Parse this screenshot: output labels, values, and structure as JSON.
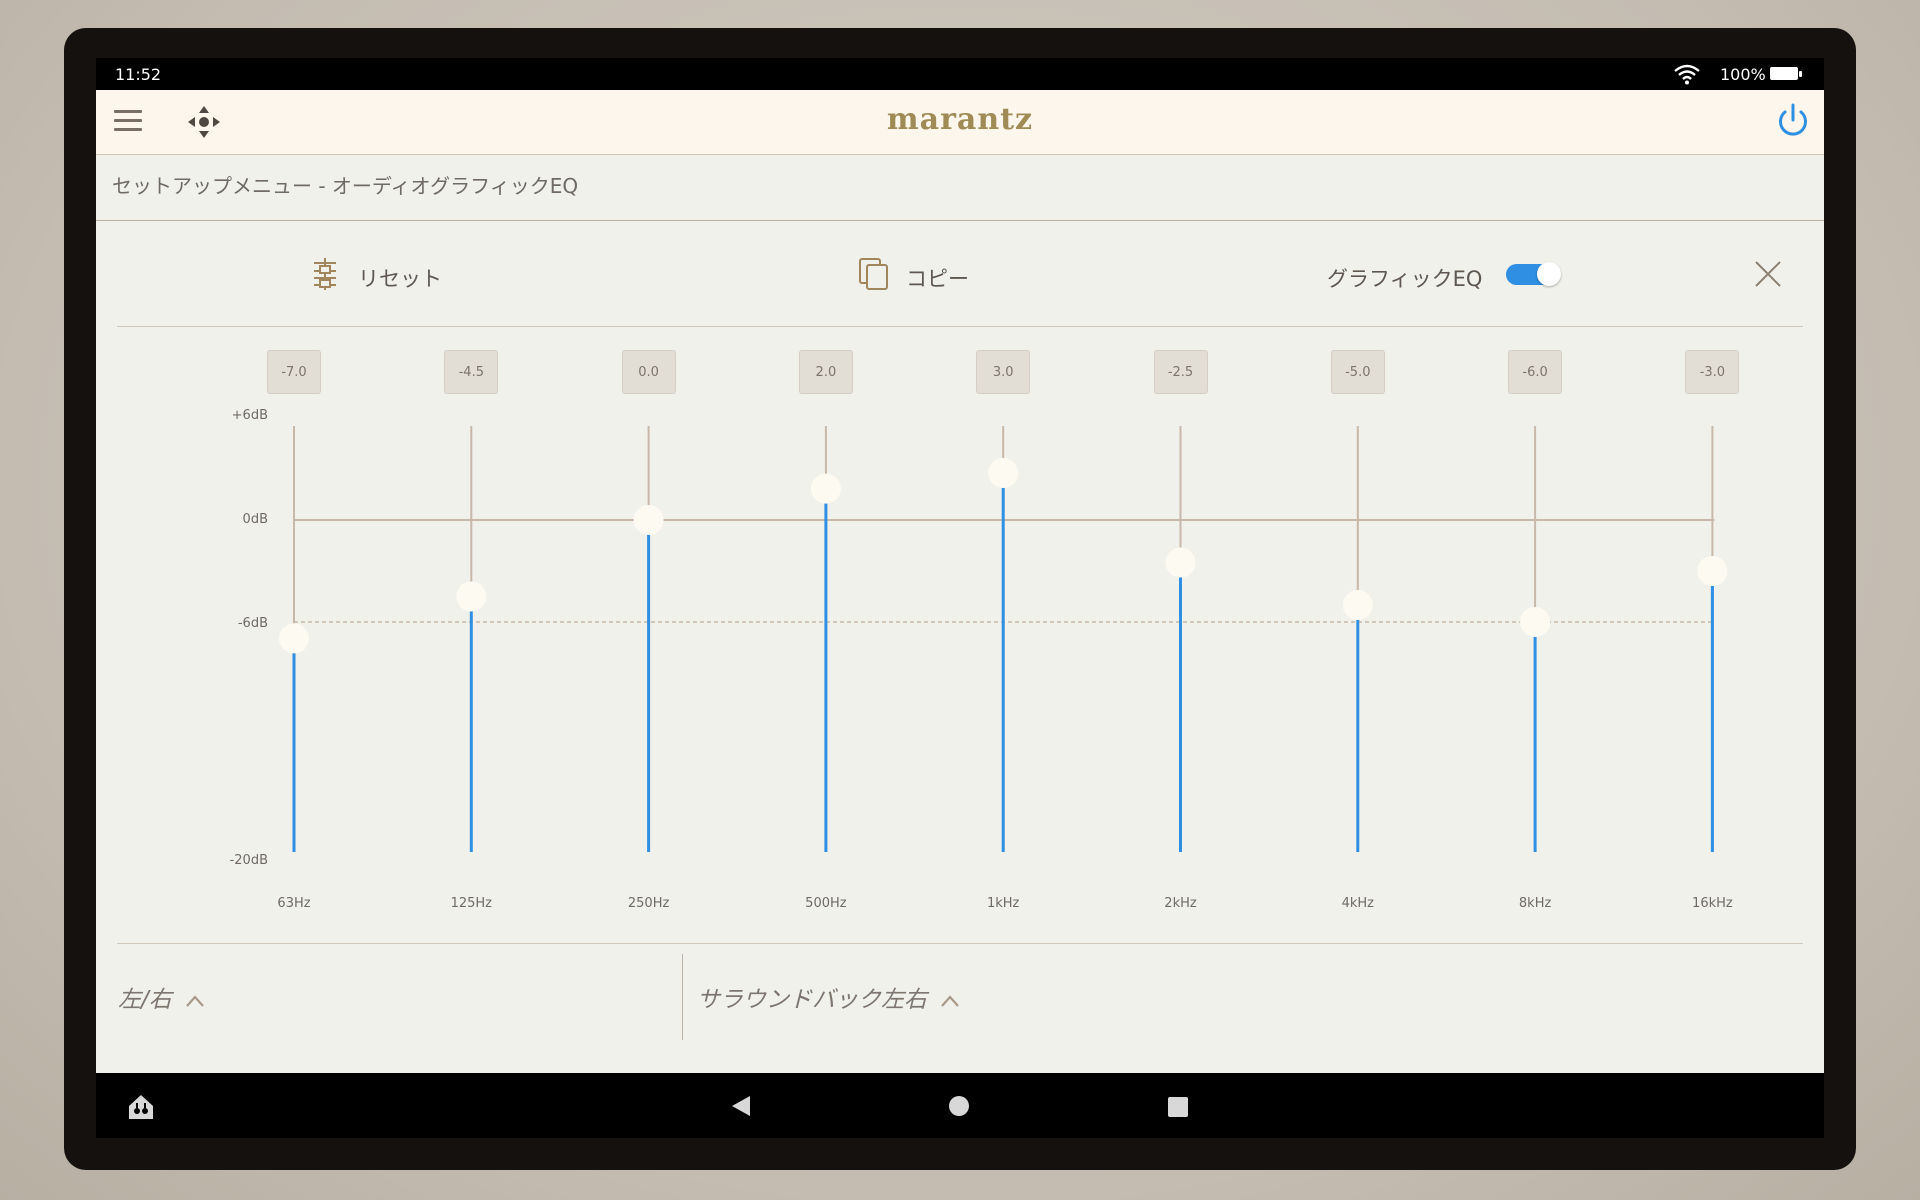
{
  "status_bar": {
    "time": "11:52",
    "battery": "100%"
  },
  "app_bar": {
    "logo": "marantz"
  },
  "breadcrumb": "セットアップメニュー - オーディオグラフィックEQ",
  "toolbar": {
    "reset_label": "リセット",
    "copy_label": "コピー",
    "graphic_eq_label": "グラフィックEQ",
    "graphic_eq_enabled": true
  },
  "eq": {
    "db_scale": [
      "+6dB",
      "0dB",
      "-6dB",
      "-20dB"
    ],
    "range_db": [
      -20,
      6
    ],
    "bands": [
      {
        "freq": "63Hz",
        "value": "-7.0"
      },
      {
        "freq": "125Hz",
        "value": "-4.5"
      },
      {
        "freq": "250Hz",
        "value": "0.0"
      },
      {
        "freq": "500Hz",
        "value": "2.0"
      },
      {
        "freq": "1kHz",
        "value": "3.0"
      },
      {
        "freq": "2kHz",
        "value": "-2.5"
      },
      {
        "freq": "4kHz",
        "value": "-5.0"
      },
      {
        "freq": "8kHz",
        "value": "-6.0"
      },
      {
        "freq": "16kHz",
        "value": "-3.0"
      }
    ]
  },
  "channel_tabs": {
    "left": "左/右",
    "right": "サラウンドバック左右"
  },
  "colors": {
    "accent": "#2f8fe3",
    "track": "#c8b8a8",
    "brand": "#a08a55"
  }
}
